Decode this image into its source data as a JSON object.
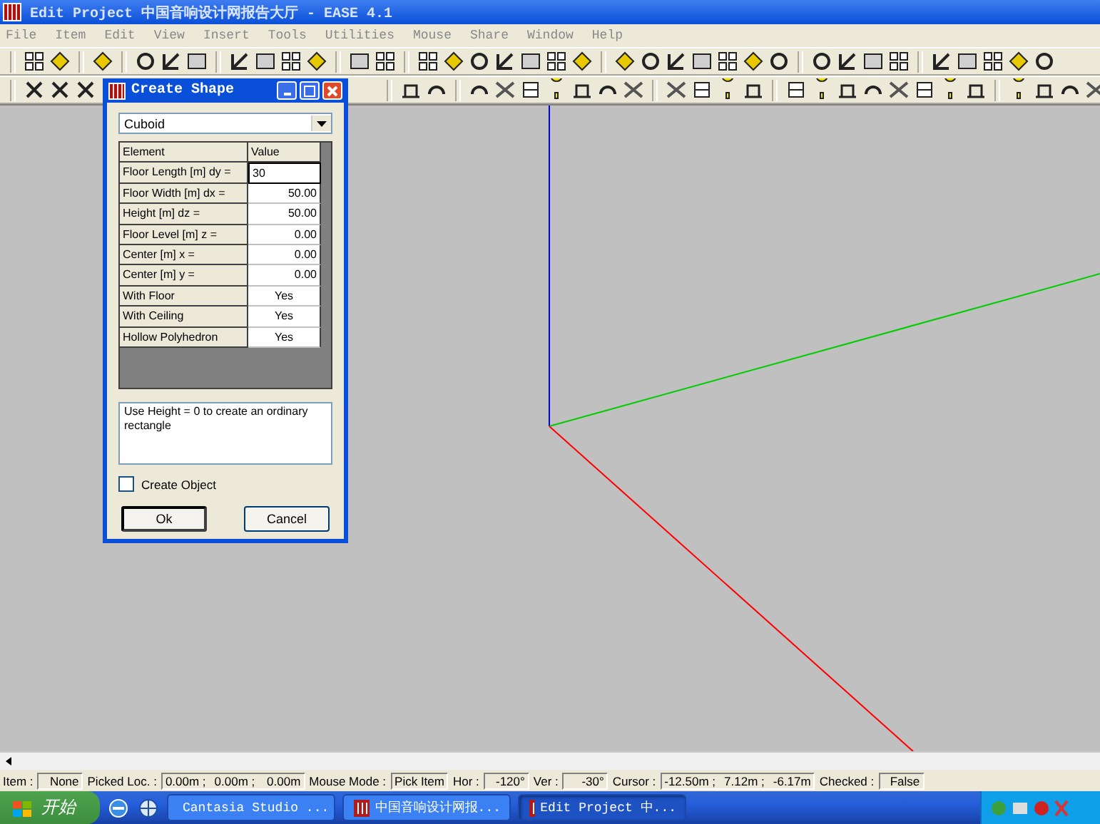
{
  "window": {
    "title": "Edit Project 中国音响设计网报告大厅 - EASE 4.1"
  },
  "menu": [
    "File",
    "Item",
    "Edit",
    "View",
    "Insert",
    "Tools",
    "Utilities",
    "Mouse",
    "Share",
    "Window",
    "Help"
  ],
  "dialog": {
    "title": "Create Shape",
    "shape": "Cuboid",
    "columns": [
      "Element",
      "Value"
    ],
    "rows": [
      {
        "element": "Floor  Length [m] dy =",
        "value": "30",
        "kind": "editing"
      },
      {
        "element": "Floor Width [m] dx =",
        "value": "50.00",
        "kind": "number"
      },
      {
        "element": "Height [m] dz =",
        "value": "50.00",
        "kind": "number"
      },
      {
        "element": "Floor Level [m] z =",
        "value": "0.00",
        "kind": "number"
      },
      {
        "element": "Center [m] x =",
        "value": "0.00",
        "kind": "number"
      },
      {
        "element": "Center [m] y =",
        "value": "0.00",
        "kind": "number"
      },
      {
        "element": "With Floor",
        "value": "Yes",
        "kind": "choice"
      },
      {
        "element": "With Ceiling",
        "value": "Yes",
        "kind": "choice"
      },
      {
        "element": "Hollow Polyhedron",
        "value": "Yes",
        "kind": "choice"
      }
    ],
    "hint": "Use Height = 0 to create an ordinary rectangle",
    "create_object": {
      "label": "Create Object",
      "checked": false
    },
    "buttons": [
      "Ok",
      "Cancel"
    ]
  },
  "status_bar": [
    {
      "label": "Item :",
      "values": [
        "None"
      ]
    },
    {
      "label": "Picked Loc. :",
      "values": [
        "0.00m ;",
        "0.00m ;",
        "0.00m"
      ]
    },
    {
      "label": "Mouse Mode :",
      "values": [
        "Pick Item"
      ]
    },
    {
      "label": "Hor :",
      "values": [
        "-120°"
      ]
    },
    {
      "label": "Ver :",
      "values": [
        "-30°"
      ]
    },
    {
      "label": "Cursor :",
      "values": [
        "-12.50m ;",
        "7.12m ;",
        "-6.17m"
      ]
    },
    {
      "label": "Checked :",
      "values": [
        "False"
      ]
    }
  ],
  "taskbar": {
    "start": "开始",
    "tasks": [
      {
        "label": "Cantasia Studio ...",
        "selected": false,
        "kind": "green"
      },
      {
        "label": "中国音响设计网报...",
        "selected": false,
        "kind": "ease"
      },
      {
        "label": "Edit Project 中...",
        "selected": true,
        "kind": "ease"
      }
    ]
  }
}
